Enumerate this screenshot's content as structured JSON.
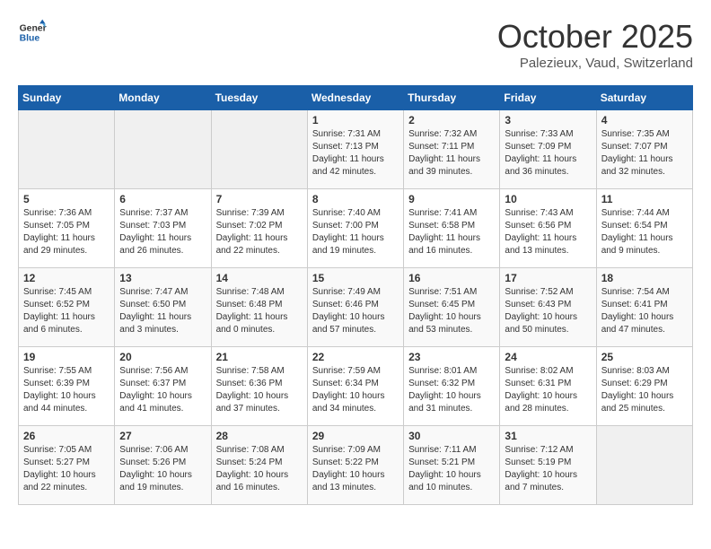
{
  "logo": {
    "text_general": "General",
    "text_blue": "Blue"
  },
  "header": {
    "month": "October 2025",
    "location": "Palezieux, Vaud, Switzerland"
  },
  "weekdays": [
    "Sunday",
    "Monday",
    "Tuesday",
    "Wednesday",
    "Thursday",
    "Friday",
    "Saturday"
  ],
  "weeks": [
    [
      {
        "day": "",
        "info": ""
      },
      {
        "day": "",
        "info": ""
      },
      {
        "day": "",
        "info": ""
      },
      {
        "day": "1",
        "info": "Sunrise: 7:31 AM\nSunset: 7:13 PM\nDaylight: 11 hours and 42 minutes."
      },
      {
        "day": "2",
        "info": "Sunrise: 7:32 AM\nSunset: 7:11 PM\nDaylight: 11 hours and 39 minutes."
      },
      {
        "day": "3",
        "info": "Sunrise: 7:33 AM\nSunset: 7:09 PM\nDaylight: 11 hours and 36 minutes."
      },
      {
        "day": "4",
        "info": "Sunrise: 7:35 AM\nSunset: 7:07 PM\nDaylight: 11 hours and 32 minutes."
      }
    ],
    [
      {
        "day": "5",
        "info": "Sunrise: 7:36 AM\nSunset: 7:05 PM\nDaylight: 11 hours and 29 minutes."
      },
      {
        "day": "6",
        "info": "Sunrise: 7:37 AM\nSunset: 7:03 PM\nDaylight: 11 hours and 26 minutes."
      },
      {
        "day": "7",
        "info": "Sunrise: 7:39 AM\nSunset: 7:02 PM\nDaylight: 11 hours and 22 minutes."
      },
      {
        "day": "8",
        "info": "Sunrise: 7:40 AM\nSunset: 7:00 PM\nDaylight: 11 hours and 19 minutes."
      },
      {
        "day": "9",
        "info": "Sunrise: 7:41 AM\nSunset: 6:58 PM\nDaylight: 11 hours and 16 minutes."
      },
      {
        "day": "10",
        "info": "Sunrise: 7:43 AM\nSunset: 6:56 PM\nDaylight: 11 hours and 13 minutes."
      },
      {
        "day": "11",
        "info": "Sunrise: 7:44 AM\nSunset: 6:54 PM\nDaylight: 11 hours and 9 minutes."
      }
    ],
    [
      {
        "day": "12",
        "info": "Sunrise: 7:45 AM\nSunset: 6:52 PM\nDaylight: 11 hours and 6 minutes."
      },
      {
        "day": "13",
        "info": "Sunrise: 7:47 AM\nSunset: 6:50 PM\nDaylight: 11 hours and 3 minutes."
      },
      {
        "day": "14",
        "info": "Sunrise: 7:48 AM\nSunset: 6:48 PM\nDaylight: 11 hours and 0 minutes."
      },
      {
        "day": "15",
        "info": "Sunrise: 7:49 AM\nSunset: 6:46 PM\nDaylight: 10 hours and 57 minutes."
      },
      {
        "day": "16",
        "info": "Sunrise: 7:51 AM\nSunset: 6:45 PM\nDaylight: 10 hours and 53 minutes."
      },
      {
        "day": "17",
        "info": "Sunrise: 7:52 AM\nSunset: 6:43 PM\nDaylight: 10 hours and 50 minutes."
      },
      {
        "day": "18",
        "info": "Sunrise: 7:54 AM\nSunset: 6:41 PM\nDaylight: 10 hours and 47 minutes."
      }
    ],
    [
      {
        "day": "19",
        "info": "Sunrise: 7:55 AM\nSunset: 6:39 PM\nDaylight: 10 hours and 44 minutes."
      },
      {
        "day": "20",
        "info": "Sunrise: 7:56 AM\nSunset: 6:37 PM\nDaylight: 10 hours and 41 minutes."
      },
      {
        "day": "21",
        "info": "Sunrise: 7:58 AM\nSunset: 6:36 PM\nDaylight: 10 hours and 37 minutes."
      },
      {
        "day": "22",
        "info": "Sunrise: 7:59 AM\nSunset: 6:34 PM\nDaylight: 10 hours and 34 minutes."
      },
      {
        "day": "23",
        "info": "Sunrise: 8:01 AM\nSunset: 6:32 PM\nDaylight: 10 hours and 31 minutes."
      },
      {
        "day": "24",
        "info": "Sunrise: 8:02 AM\nSunset: 6:31 PM\nDaylight: 10 hours and 28 minutes."
      },
      {
        "day": "25",
        "info": "Sunrise: 8:03 AM\nSunset: 6:29 PM\nDaylight: 10 hours and 25 minutes."
      }
    ],
    [
      {
        "day": "26",
        "info": "Sunrise: 7:05 AM\nSunset: 5:27 PM\nDaylight: 10 hours and 22 minutes."
      },
      {
        "day": "27",
        "info": "Sunrise: 7:06 AM\nSunset: 5:26 PM\nDaylight: 10 hours and 19 minutes."
      },
      {
        "day": "28",
        "info": "Sunrise: 7:08 AM\nSunset: 5:24 PM\nDaylight: 10 hours and 16 minutes."
      },
      {
        "day": "29",
        "info": "Sunrise: 7:09 AM\nSunset: 5:22 PM\nDaylight: 10 hours and 13 minutes."
      },
      {
        "day": "30",
        "info": "Sunrise: 7:11 AM\nSunset: 5:21 PM\nDaylight: 10 hours and 10 minutes."
      },
      {
        "day": "31",
        "info": "Sunrise: 7:12 AM\nSunset: 5:19 PM\nDaylight: 10 hours and 7 minutes."
      },
      {
        "day": "",
        "info": ""
      }
    ]
  ]
}
